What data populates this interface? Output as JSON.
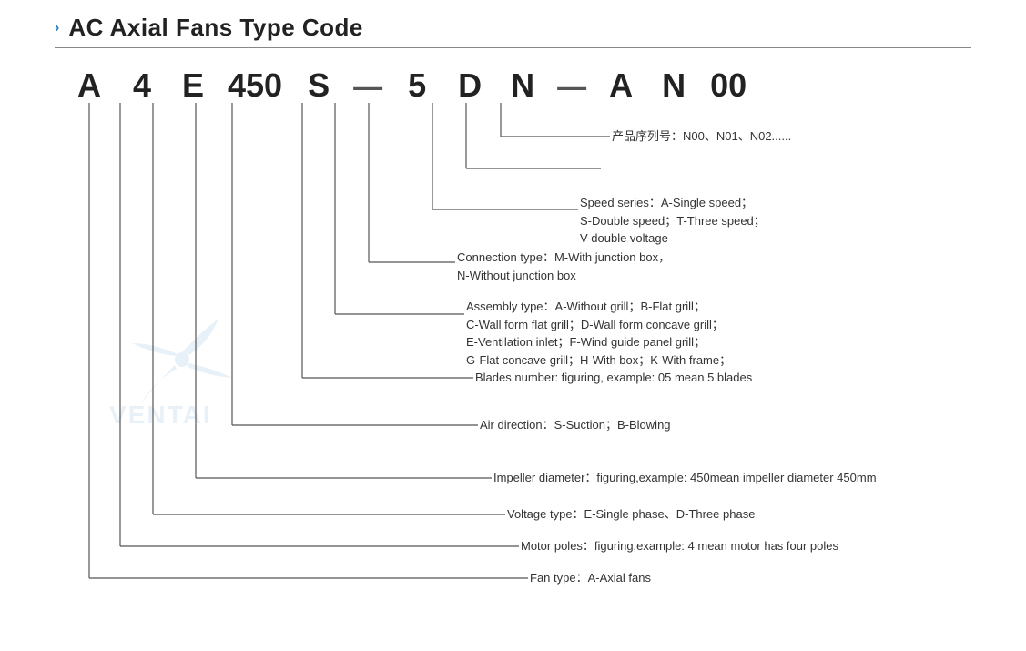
{
  "title": "AC Axial Fans Type Code",
  "chevron": "›",
  "code_letters": [
    "A",
    "4",
    "E",
    "450",
    "S",
    "—",
    "5",
    "D",
    "N",
    "—",
    "A",
    "N",
    "00"
  ],
  "labels": {
    "product_series": "产品序列号：N00、N01、N02......",
    "speed_series": "Speed series：A-Single speed；",
    "speed_series2": "S-Double speed；T-Three speed；",
    "speed_series3": "V-double voltage",
    "connection_type": "Connection type：M-With junction box，",
    "connection_type2": "N-Without junction box",
    "assembly_type": "Assembly type：A-Without grill；B-Flat grill；",
    "assembly_type2": "C-Wall form flat grill；D-Wall form concave grill；",
    "assembly_type3": "E-Ventilation inlet；F-Wind guide panel grill；",
    "assembly_type4": "G-Flat concave grill；H-With box；K-With frame；",
    "blades": "Blades number: figuring, example: 05 mean 5 blades",
    "air_direction": "Air direction：S-Suction；B-Blowing",
    "impeller": "Impeller diameter：figuring,example: 450mean impeller diameter 450mm",
    "voltage": "Voltage type：E-Single phase、D-Three phase",
    "motor_poles": "Motor poles：figuring,example: 4 mean motor has four poles",
    "fan_type": "Fan type：A-Axial fans"
  }
}
